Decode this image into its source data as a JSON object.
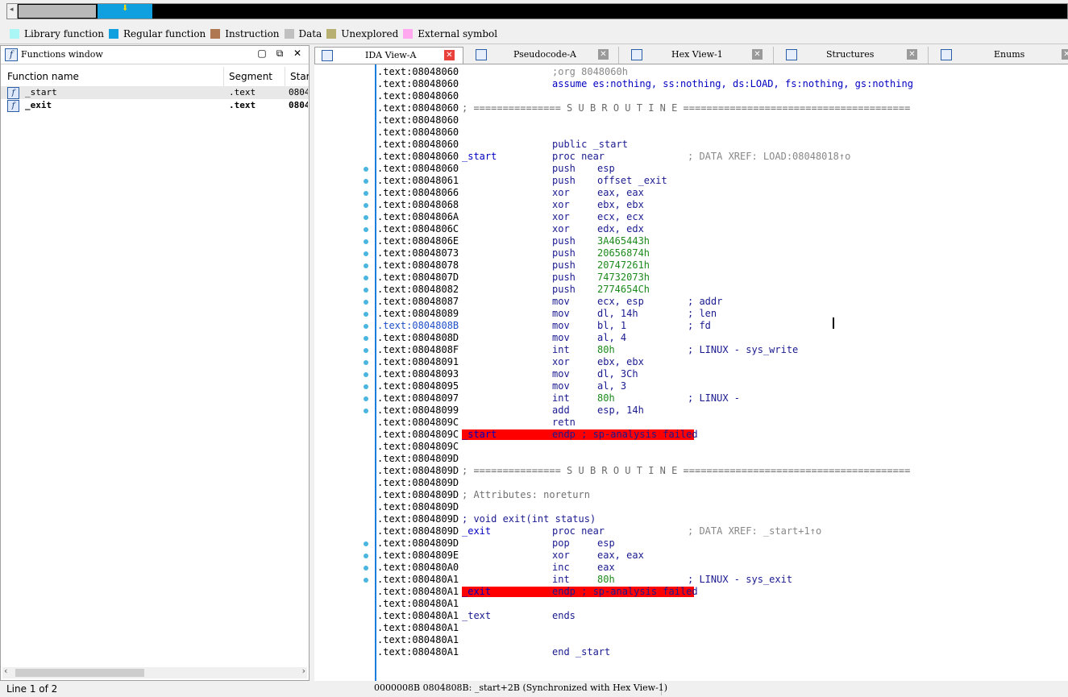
{
  "navband": {
    "arrow_glyph": "⬇"
  },
  "legend": [
    {
      "label": "Library function",
      "color": "#aaf5f5"
    },
    {
      "label": "Regular function",
      "color": "#10a0e0"
    },
    {
      "label": "Instruction",
      "color": "#b07850"
    },
    {
      "label": "Data",
      "color": "#c0c0c0"
    },
    {
      "label": "Unexplored",
      "color": "#b8b070"
    },
    {
      "label": "External symbol",
      "color": "#ffa8f0"
    }
  ],
  "functions_window": {
    "title": "Functions window",
    "columns": [
      "Function name",
      "Segment",
      "Star"
    ],
    "rows": [
      {
        "name": "_start",
        "segment": ".text",
        "start": "0804"
      },
      {
        "name": "_exit",
        "segment": ".text",
        "start": "0804"
      }
    ],
    "status": "Line 1 of 2"
  },
  "tabs": [
    {
      "label": "IDA View-A",
      "active": true
    },
    {
      "label": "Pseudocode-A",
      "active": false
    },
    {
      "label": "Hex View-1",
      "active": false
    },
    {
      "label": "Structures",
      "active": false
    },
    {
      "label": "Enums",
      "active": false
    }
  ],
  "listing": [
    {
      "addr": ".text:08048060",
      "op": ";org 8048060h",
      "opclass": "k-gray"
    },
    {
      "addr": ".text:08048060",
      "op": "assume es:nothing, ss:nothing, ds:LOAD, fs:nothing, gs:nothing",
      "opclass": "k-blue"
    },
    {
      "addr": ".text:08048060"
    },
    {
      "addr": ".text:08048060",
      "label": "; =============== S U B R O U T I N E =======================================",
      "labelclass": "k-note"
    },
    {
      "addr": ".text:08048060"
    },
    {
      "addr": ".text:08048060"
    },
    {
      "addr": ".text:08048060",
      "op": "public _start",
      "opclass": "k-navy"
    },
    {
      "addr": ".text:08048060",
      "label": "_start",
      "labelclass": "k-blue",
      "op": "proc near",
      "opclass": "k-navy",
      "cmt": "; DATA XREF: LOAD:08048018↑o",
      "cmtclass": "k-gray"
    },
    {
      "addr": ".text:08048060",
      "op": "push",
      "arg": "esp",
      "argclass": "k-navy"
    },
    {
      "addr": ".text:08048061",
      "op": "push",
      "arg": "offset _exit",
      "argclass": "k-navy"
    },
    {
      "addr": ".text:08048066",
      "op": "xor",
      "arg": "eax, eax",
      "argclass": "k-navy"
    },
    {
      "addr": ".text:08048068",
      "op": "xor",
      "arg": "ebx, ebx",
      "argclass": "k-navy"
    },
    {
      "addr": ".text:0804806A",
      "op": "xor",
      "arg": "ecx, ecx",
      "argclass": "k-navy"
    },
    {
      "addr": ".text:0804806C",
      "op": "xor",
      "arg": "edx, edx",
      "argclass": "k-navy"
    },
    {
      "addr": ".text:0804806E",
      "op": "push",
      "arg": "3A465443h",
      "argclass": "k-green"
    },
    {
      "addr": ".text:08048073",
      "op": "push",
      "arg": "20656874h",
      "argclass": "k-green"
    },
    {
      "addr": ".text:08048078",
      "op": "push",
      "arg": "20747261h",
      "argclass": "k-green"
    },
    {
      "addr": ".text:0804807D",
      "op": "push",
      "arg": "74732073h",
      "argclass": "k-green"
    },
    {
      "addr": ".text:08048082",
      "op": "push",
      "arg": "2774654Ch",
      "argclass": "k-green"
    },
    {
      "addr": ".text:08048087",
      "op": "mov",
      "arg": "ecx, esp",
      "argclass": "k-navy",
      "cmt": "; addr",
      "cmtclass": "k-navy"
    },
    {
      "addr": ".text:08048089",
      "op": "mov",
      "arg": "dl, 14h",
      "argclass": "k-navy",
      "cmt": "; len",
      "cmtclass": "k-navy"
    },
    {
      "addr": ".text:0804808B",
      "addrhl": true,
      "op": "mov",
      "arg": "bl, 1",
      "argclass": "k-navy",
      "cmt": "; fd",
      "cmtclass": "k-navy"
    },
    {
      "addr": ".text:0804808D",
      "op": "mov",
      "arg": "al, 4",
      "argclass": "k-navy"
    },
    {
      "addr": ".text:0804808F",
      "op": "int",
      "arg": "80h",
      "argclass": "k-green",
      "cmt": "; LINUX - sys_write",
      "cmtclass": "k-navy"
    },
    {
      "addr": ".text:08048091",
      "op": "xor",
      "arg": "ebx, ebx",
      "argclass": "k-navy"
    },
    {
      "addr": ".text:08048093",
      "op": "mov",
      "arg": "dl, 3Ch",
      "argclass": "k-navy"
    },
    {
      "addr": ".text:08048095",
      "op": "mov",
      "arg": "al, 3",
      "argclass": "k-navy"
    },
    {
      "addr": ".text:08048097",
      "op": "int",
      "arg": "80h",
      "argclass": "k-green",
      "cmt": "; LINUX -",
      "cmtclass": "k-navy"
    },
    {
      "addr": ".text:08048099",
      "op": "add",
      "arg": "esp, 14h",
      "argclass": "k-navy"
    },
    {
      "addr": ".text:0804809C",
      "op": "retn"
    },
    {
      "addr": ".text:0804809C",
      "red": true,
      "label": "_start",
      "labelclass": "k-blue",
      "op": "endp ; sp-analysis failed",
      "opclass": "k-navy"
    },
    {
      "addr": ".text:0804809C"
    },
    {
      "addr": ".text:0804809D"
    },
    {
      "addr": ".text:0804809D",
      "label": "; =============== S U B R O U T I N E =======================================",
      "labelclass": "k-note"
    },
    {
      "addr": ".text:0804809D"
    },
    {
      "addr": ".text:0804809D",
      "label": "; Attributes: noreturn",
      "labelclass": "k-attr"
    },
    {
      "addr": ".text:0804809D"
    },
    {
      "addr": ".text:0804809D",
      "label": "; void exit(int status)",
      "labelclass": "k-navy"
    },
    {
      "addr": ".text:0804809D",
      "label": "_exit",
      "labelclass": "k-blue",
      "op": "proc near",
      "opclass": "k-navy",
      "cmt": "; DATA XREF: _start+1↑o",
      "cmtclass": "k-gray"
    },
    {
      "addr": ".text:0804809D",
      "op": "pop",
      "arg": "esp",
      "argclass": "k-navy"
    },
    {
      "addr": ".text:0804809E",
      "op": "xor",
      "arg": "eax, eax",
      "argclass": "k-navy"
    },
    {
      "addr": ".text:080480A0",
      "op": "inc",
      "arg": "eax",
      "argclass": "k-navy"
    },
    {
      "addr": ".text:080480A1",
      "op": "int",
      "arg": "80h",
      "argclass": "k-green",
      "cmt": "; LINUX - sys_exit",
      "cmtclass": "k-navy"
    },
    {
      "addr": ".text:080480A1",
      "red": true,
      "label": "_exit",
      "labelclass": "k-blue",
      "op": "endp ; sp-analysis failed",
      "opclass": "k-navy"
    },
    {
      "addr": ".text:080480A1"
    },
    {
      "addr": ".text:080480A1",
      "label": "_text",
      "labelclass": "k-navy",
      "op": "ends",
      "opclass": "k-navy"
    },
    {
      "addr": ".text:080480A1"
    },
    {
      "addr": ".text:080480A1"
    },
    {
      "addr": ".text:080480A1",
      "op": "end _start",
      "opclass": "k-navy"
    }
  ],
  "status_bar": "0000008B 0804808B: _start+2B (Synchronized with Hex View-1)"
}
